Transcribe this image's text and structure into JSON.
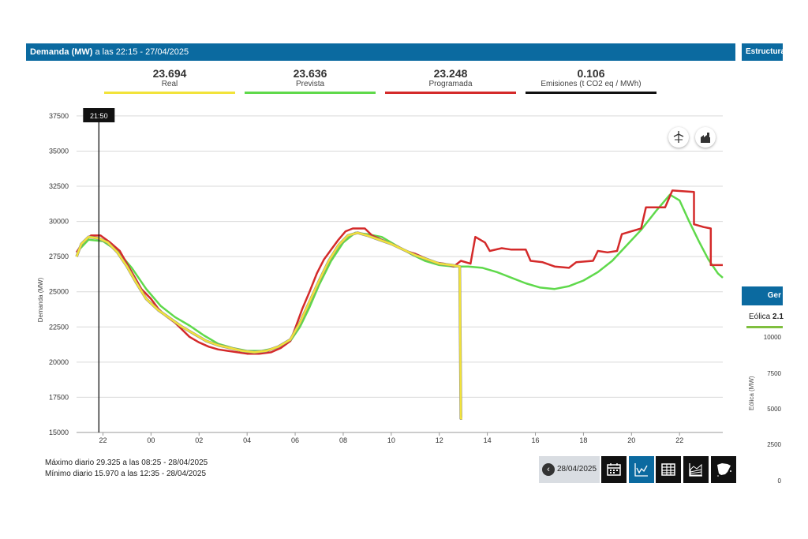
{
  "header": {
    "title_bold": "Demanda (MW)",
    "title_rest": " a las 22:15 - 27/04/2025",
    "right_title": "Estructura"
  },
  "stats": [
    {
      "value": "23.694",
      "label": "Real",
      "color": "#f2e33a"
    },
    {
      "value": "23.636",
      "label": "Prevista",
      "color": "#5fd94b"
    },
    {
      "value": "23.248",
      "label": "Programada",
      "color": "#d42a2a"
    },
    {
      "value": "0.106",
      "label": "Emisiones (t CO2 eq / MWh)",
      "color": "#111111"
    }
  ],
  "cursor_label": "21:50",
  "footer": {
    "max": "Máximo diario 29.325 a las 08:25 - 28/04/2025",
    "min": "Mínimo diario 15.970 a las 12:35 - 28/04/2025"
  },
  "controls": {
    "date": "28/04/2025",
    "prev_icon": "chevron-left-icon",
    "buttons": [
      "calendar-icon",
      "line-chart-icon",
      "table-icon",
      "area-chart-icon",
      "spain-map-icon"
    ],
    "active": "line-chart-icon"
  },
  "chart_buttons": [
    "wind-turbine-icon",
    "factory-icon"
  ],
  "right_panel": {
    "head": "Ger",
    "eolica_label": "Eólica",
    "eolica_value": "2.1",
    "ticks": [
      "10000",
      "7500",
      "5000",
      "2500",
      "0"
    ],
    "ylabel": "Eólica (MW)"
  },
  "chart_data": {
    "type": "line",
    "ylabel": "Demanda (MW)",
    "ylim": [
      15000,
      38000
    ],
    "yticks": [
      15000,
      17500,
      20000,
      22500,
      25000,
      27500,
      30000,
      32500,
      35000,
      37500
    ],
    "xlim": [
      20.9,
      47.8
    ],
    "xticks": [
      {
        "h": 22,
        "label": "22"
      },
      {
        "h": 24,
        "label": "00"
      },
      {
        "h": 26,
        "label": "02"
      },
      {
        "h": 28,
        "label": "04"
      },
      {
        "h": 30,
        "label": "06"
      },
      {
        "h": 32,
        "label": "08"
      },
      {
        "h": 34,
        "label": "10"
      },
      {
        "h": 36,
        "label": "12"
      },
      {
        "h": 38,
        "label": "14"
      },
      {
        "h": 40,
        "label": "16"
      },
      {
        "h": 42,
        "label": "18"
      },
      {
        "h": 44,
        "label": "20"
      },
      {
        "h": 46,
        "label": "22"
      }
    ],
    "cursor_x": 21.83,
    "grid": true,
    "series": [
      {
        "name": "Real",
        "color": "#f2e33a",
        "points": [
          [
            20.9,
            27500
          ],
          [
            21.1,
            28400
          ],
          [
            21.4,
            28900
          ],
          [
            21.83,
            28800
          ],
          [
            22.2,
            28500
          ],
          [
            22.6,
            27800
          ],
          [
            23.0,
            26800
          ],
          [
            23.4,
            25600
          ],
          [
            23.8,
            24500
          ],
          [
            24.3,
            23700
          ],
          [
            24.8,
            23100
          ],
          [
            25.3,
            22500
          ],
          [
            25.8,
            22000
          ],
          [
            26.3,
            21500
          ],
          [
            26.8,
            21200
          ],
          [
            27.3,
            21000
          ],
          [
            27.8,
            20800
          ],
          [
            28.3,
            20700
          ],
          [
            28.8,
            20800
          ],
          [
            29.3,
            21100
          ],
          [
            29.8,
            21600
          ],
          [
            30.2,
            22800
          ],
          [
            30.6,
            24300
          ],
          [
            31.0,
            25800
          ],
          [
            31.4,
            27200
          ],
          [
            31.8,
            28300
          ],
          [
            32.2,
            29000
          ],
          [
            32.6,
            29200
          ],
          [
            33.0,
            29000
          ],
          [
            33.5,
            28700
          ],
          [
            34.0,
            28400
          ],
          [
            34.5,
            28000
          ],
          [
            35.0,
            27600
          ],
          [
            35.5,
            27300
          ],
          [
            36.0,
            27000
          ],
          [
            36.5,
            26900
          ],
          [
            36.85,
            26800
          ],
          [
            36.9,
            16000
          ],
          [
            36.95,
            16000
          ]
        ]
      },
      {
        "name": "Prevista",
        "color": "#5fd94b",
        "points": [
          [
            20.9,
            27800
          ],
          [
            21.4,
            28700
          ],
          [
            22.0,
            28600
          ],
          [
            22.6,
            27900
          ],
          [
            23.2,
            26700
          ],
          [
            23.8,
            25200
          ],
          [
            24.4,
            24000
          ],
          [
            25.0,
            23200
          ],
          [
            25.6,
            22600
          ],
          [
            26.2,
            21900
          ],
          [
            26.8,
            21300
          ],
          [
            27.4,
            21000
          ],
          [
            28.0,
            20800
          ],
          [
            28.6,
            20800
          ],
          [
            29.2,
            21000
          ],
          [
            29.8,
            21500
          ],
          [
            30.2,
            22500
          ],
          [
            30.6,
            23900
          ],
          [
            31.0,
            25500
          ],
          [
            31.5,
            27200
          ],
          [
            32.0,
            28500
          ],
          [
            32.5,
            29200
          ],
          [
            33.0,
            29100
          ],
          [
            33.6,
            28900
          ],
          [
            34.2,
            28300
          ],
          [
            34.8,
            27700
          ],
          [
            35.4,
            27200
          ],
          [
            36.0,
            26900
          ],
          [
            36.6,
            26800
          ],
          [
            37.2,
            26800
          ],
          [
            37.8,
            26700
          ],
          [
            38.4,
            26400
          ],
          [
            39.0,
            26000
          ],
          [
            39.6,
            25600
          ],
          [
            40.2,
            25300
          ],
          [
            40.8,
            25200
          ],
          [
            41.4,
            25400
          ],
          [
            42.0,
            25800
          ],
          [
            42.6,
            26400
          ],
          [
            43.2,
            27200
          ],
          [
            43.8,
            28300
          ],
          [
            44.4,
            29400
          ],
          [
            45.0,
            30700
          ],
          [
            45.6,
            31900
          ],
          [
            46.0,
            31500
          ],
          [
            46.4,
            30000
          ],
          [
            46.8,
            28600
          ],
          [
            47.2,
            27300
          ],
          [
            47.6,
            26300
          ],
          [
            47.8,
            26000
          ]
        ]
      },
      {
        "name": "Programada",
        "color": "#d42a2a",
        "points": [
          [
            20.9,
            27800
          ],
          [
            21.2,
            28600
          ],
          [
            21.5,
            29000
          ],
          [
            21.9,
            29000
          ],
          [
            22.3,
            28500
          ],
          [
            22.7,
            27900
          ],
          [
            23.0,
            27000
          ],
          [
            23.3,
            26100
          ],
          [
            23.6,
            25200
          ],
          [
            24.0,
            24500
          ],
          [
            24.3,
            23800
          ],
          [
            24.6,
            23300
          ],
          [
            25.0,
            22800
          ],
          [
            25.3,
            22300
          ],
          [
            25.6,
            21800
          ],
          [
            26.0,
            21400
          ],
          [
            26.4,
            21100
          ],
          [
            26.8,
            20900
          ],
          [
            27.2,
            20800
          ],
          [
            27.6,
            20700
          ],
          [
            28.0,
            20600
          ],
          [
            28.5,
            20600
          ],
          [
            29.0,
            20700
          ],
          [
            29.4,
            21000
          ],
          [
            29.8,
            21500
          ],
          [
            30.0,
            22400
          ],
          [
            30.3,
            23800
          ],
          [
            30.6,
            25000
          ],
          [
            30.9,
            26300
          ],
          [
            31.2,
            27300
          ],
          [
            31.5,
            28000
          ],
          [
            31.8,
            28700
          ],
          [
            32.1,
            29300
          ],
          [
            32.4,
            29500
          ],
          [
            32.9,
            29500
          ],
          [
            33.2,
            29000
          ],
          [
            33.6,
            28700
          ],
          [
            34.0,
            28400
          ],
          [
            34.3,
            28200
          ],
          [
            34.6,
            27900
          ],
          [
            35.0,
            27700
          ],
          [
            35.4,
            27400
          ],
          [
            35.8,
            27100
          ],
          [
            36.2,
            27000
          ],
          [
            36.6,
            26800
          ],
          [
            36.9,
            27200
          ],
          [
            37.3,
            27000
          ],
          [
            37.5,
            28900
          ],
          [
            37.9,
            28500
          ],
          [
            38.1,
            27900
          ],
          [
            38.6,
            28100
          ],
          [
            39.0,
            28000
          ],
          [
            39.6,
            28000
          ],
          [
            39.8,
            27200
          ],
          [
            40.3,
            27100
          ],
          [
            40.8,
            26800
          ],
          [
            41.4,
            26700
          ],
          [
            41.7,
            27100
          ],
          [
            42.4,
            27200
          ],
          [
            42.6,
            27900
          ],
          [
            43.0,
            27800
          ],
          [
            43.4,
            27900
          ],
          [
            43.6,
            29100
          ],
          [
            44.0,
            29300
          ],
          [
            44.4,
            29500
          ],
          [
            44.6,
            31000
          ],
          [
            45.4,
            31000
          ],
          [
            45.7,
            32200
          ],
          [
            46.6,
            32100
          ],
          [
            46.6,
            29800
          ],
          [
            47.0,
            29600
          ],
          [
            47.3,
            29500
          ],
          [
            47.3,
            26900
          ],
          [
            47.8,
            26900
          ]
        ]
      }
    ]
  }
}
